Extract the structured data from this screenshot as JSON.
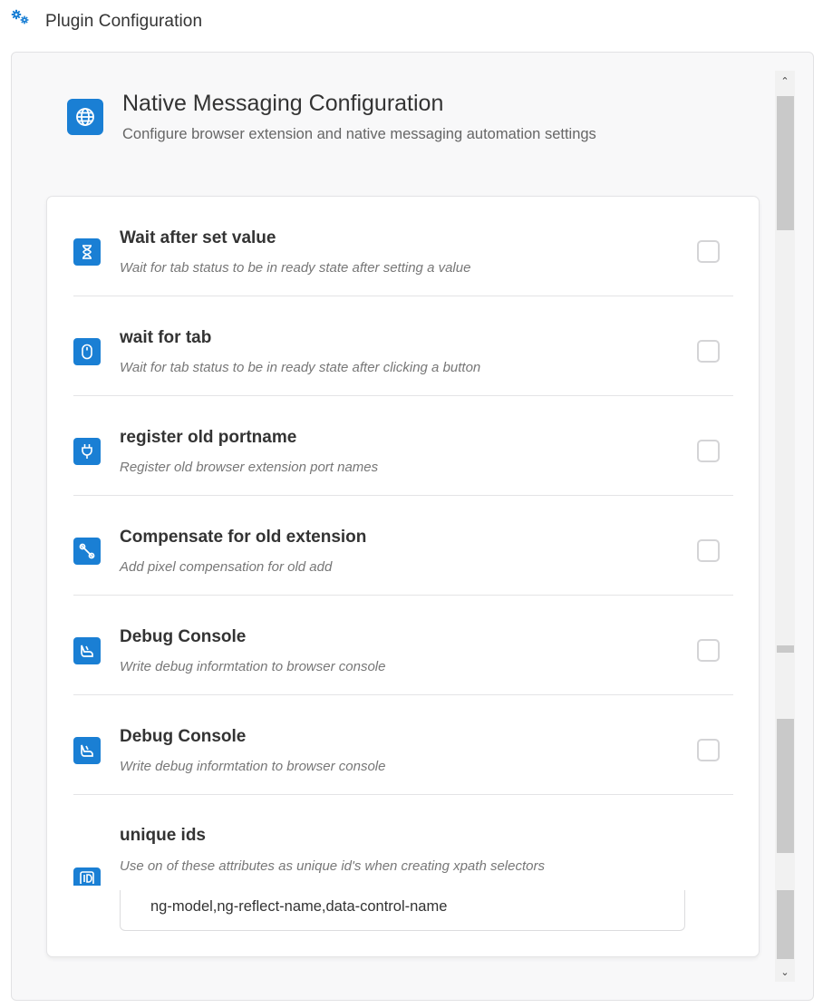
{
  "header": {
    "icon": "gears-icon",
    "title": "Plugin Configuration"
  },
  "intro": {
    "icon": "globe-icon",
    "title": "Native Messaging Configuration",
    "subtitle": "Configure browser extension and native messaging automation settings"
  },
  "settings": [
    {
      "icon": "hourglass-icon",
      "title": "Wait after set value",
      "description": "Wait for tab status to be in ready state after setting a value",
      "checked": false
    },
    {
      "icon": "mouse-icon",
      "title": "wait for tab",
      "description": "Wait for tab status to be in ready state after clicking a button",
      "checked": false
    },
    {
      "icon": "plug-icon",
      "title": "register old portname",
      "description": "Register old browser extension port names",
      "checked": false
    },
    {
      "icon": "wrench-icon",
      "title": "Compensate for old extension",
      "description": "Add pixel compensation for old add",
      "checked": false
    },
    {
      "icon": "debug-icon",
      "title": "Debug Console",
      "description": "Write debug informtation to browser console",
      "checked": false
    },
    {
      "icon": "debug-icon",
      "title": "Debug Console",
      "description": "Write debug informtation to browser console",
      "checked": false
    }
  ],
  "unique_ids": {
    "icon": "id-card-icon",
    "title": "unique ids",
    "description": "Use on of these attributes as unique id's when creating xpath selectors",
    "value": "ng-model,ng-reflect-name,data-control-name"
  },
  "scrollbar": {
    "up_arrow": "⌃",
    "down_arrow": "⌄"
  },
  "colors": {
    "accent": "#1a7fd4",
    "panel_background": "#f8f8f9",
    "card_background": "#ffffff"
  }
}
